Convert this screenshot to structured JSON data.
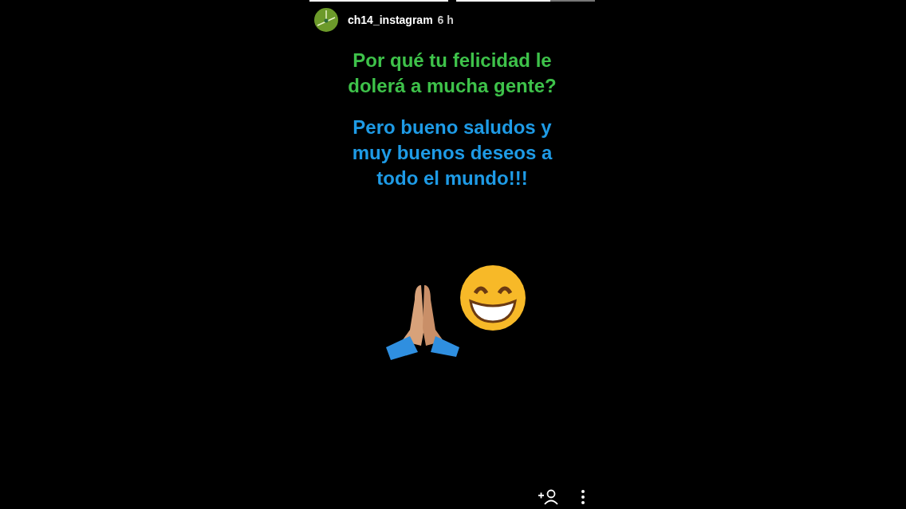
{
  "progress": [
    {
      "level": 1
    },
    {
      "level": 0.68
    }
  ],
  "header": {
    "username": "ch14_instagram",
    "time": "6 h"
  },
  "texts": [
    {
      "text": "Por qué tu felicidad le dolerá a mucha gente?",
      "color": "#3ec24a"
    },
    {
      "text": "Pero bueno saludos y muy buenos deseos a todo el mundo!!!",
      "color": "#1e9be6"
    }
  ]
}
